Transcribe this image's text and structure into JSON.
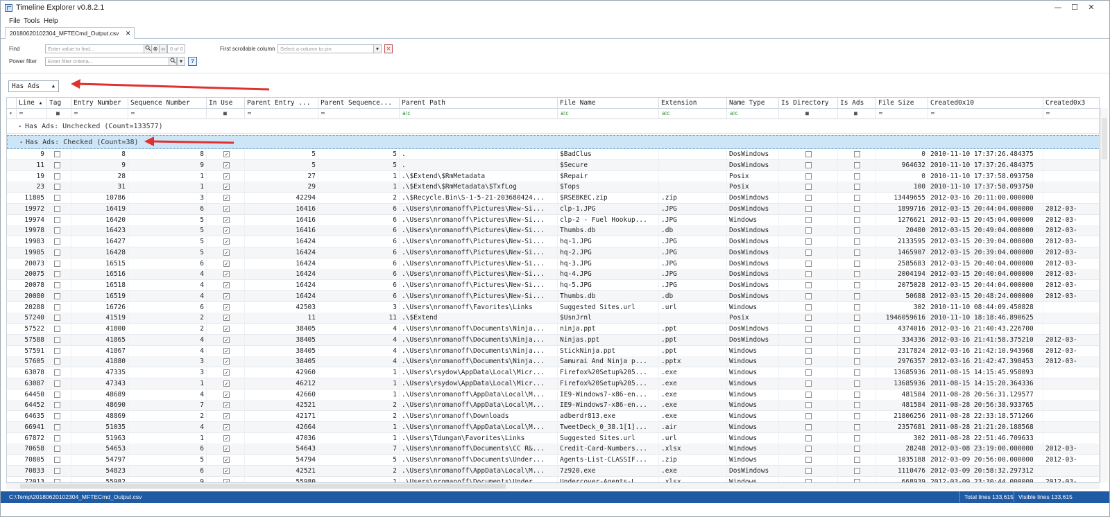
{
  "window": {
    "title": "Timeline Explorer v0.8.2.1",
    "minimize": "—",
    "maximize": "☐",
    "close": "✕"
  },
  "menu": [
    "File",
    "Tools",
    "Help"
  ],
  "tab": {
    "label": "20180620102304_MFTECmd_Output.csv",
    "close": "✕"
  },
  "find": {
    "label": "Find",
    "placeholder": "Enter value to find...",
    "counter": "0 of 0",
    "power_filter_label": "Power filter",
    "power_filter_placeholder": "Enter filter criteria...",
    "help": "?",
    "first_scrollable_label": "First scrollable column",
    "first_scrollable_placeholder": "Select a column to pin"
  },
  "grouping": {
    "chip": "Has Ads"
  },
  "columns": [
    "Line",
    "Tag",
    "Entry Number",
    "Sequence Number",
    "In Use",
    "Parent Entry ...",
    "Parent Sequence...",
    "Parent Path",
    "File Name",
    "Extension",
    "Name Type",
    "Is Directory",
    "Is Ads",
    "File Size",
    "Created0x10",
    "Created0x3"
  ],
  "groups": {
    "unchecked": "Has Ads: Unchecked (Count=133577)",
    "checked": "Has Ads: Checked (Count=38)"
  },
  "rows": [
    [
      "9",
      "8",
      "8",
      "5",
      "5",
      ".",
      "$BadClus",
      "",
      "DosWindows",
      "0",
      "2010-11-10 17:37:26.484375",
      ""
    ],
    [
      "11",
      "9",
      "9",
      "5",
      "5",
      ".",
      "$Secure",
      "",
      "DosWindows",
      "964632",
      "2010-11-10 17:37:26.484375",
      ""
    ],
    [
      "19",
      "28",
      "1",
      "27",
      "1",
      ".\\$Extend\\$RmMetadata",
      "$Repair",
      "",
      "Posix",
      "0",
      "2010-11-10 17:37:58.093750",
      ""
    ],
    [
      "23",
      "31",
      "1",
      "29",
      "1",
      ".\\$Extend\\$RmMetadata\\$TxfLog",
      "$Tops",
      "",
      "Posix",
      "100",
      "2010-11-10 17:37:58.093750",
      ""
    ],
    [
      "11805",
      "10786",
      "3",
      "42294",
      "2",
      ".\\$Recycle.Bin\\S-1-5-21-203680424...",
      "$RSEBKEC.zip",
      ".zip",
      "DosWindows",
      "13449655",
      "2012-03-16 20:11:00.000000",
      ""
    ],
    [
      "19972",
      "16419",
      "6",
      "16416",
      "6",
      ".\\Users\\nromanoff\\Pictures\\New-Si...",
      "clp-1.JPG",
      ".JPG",
      "DosWindows",
      "1899716",
      "2012-03-15 20:44:04.000000",
      "2012-03-"
    ],
    [
      "19974",
      "16420",
      "5",
      "16416",
      "6",
      ".\\Users\\nromanoff\\Pictures\\New-Si...",
      "clp-2 - Fuel Hookup...",
      ".JPG",
      "Windows",
      "1276621",
      "2012-03-15 20:45:04.000000",
      "2012-03-"
    ],
    [
      "19978",
      "16423",
      "5",
      "16416",
      "6",
      ".\\Users\\nromanoff\\Pictures\\New-Si...",
      "Thumbs.db",
      ".db",
      "DosWindows",
      "20480",
      "2012-03-15 20:49:04.000000",
      "2012-03-"
    ],
    [
      "19983",
      "16427",
      "5",
      "16424",
      "6",
      ".\\Users\\nromanoff\\Pictures\\New-Si...",
      "hq-1.JPG",
      ".JPG",
      "DosWindows",
      "2133595",
      "2012-03-15 20:39:04.000000",
      "2012-03-"
    ],
    [
      "19985",
      "16428",
      "5",
      "16424",
      "6",
      ".\\Users\\nromanoff\\Pictures\\New-Si...",
      "hq-2.JPG",
      ".JPG",
      "DosWindows",
      "1465907",
      "2012-03-15 20:39:04.000000",
      "2012-03-"
    ],
    [
      "20073",
      "16515",
      "6",
      "16424",
      "6",
      ".\\Users\\nromanoff\\Pictures\\New-Si...",
      "hq-3.JPG",
      ".JPG",
      "DosWindows",
      "2585683",
      "2012-03-15 20:40:04.000000",
      "2012-03-"
    ],
    [
      "20075",
      "16516",
      "4",
      "16424",
      "6",
      ".\\Users\\nromanoff\\Pictures\\New-Si...",
      "hq-4.JPG",
      ".JPG",
      "DosWindows",
      "2004194",
      "2012-03-15 20:40:04.000000",
      "2012-03-"
    ],
    [
      "20078",
      "16518",
      "4",
      "16424",
      "6",
      ".\\Users\\nromanoff\\Pictures\\New-Si...",
      "hq-5.JPG",
      ".JPG",
      "DosWindows",
      "2075028",
      "2012-03-15 20:44:04.000000",
      "2012-03-"
    ],
    [
      "20080",
      "16519",
      "4",
      "16424",
      "6",
      ".\\Users\\nromanoff\\Pictures\\New-Si...",
      "Thumbs.db",
      ".db",
      "DosWindows",
      "50688",
      "2012-03-15 20:48:24.000000",
      "2012-03-"
    ],
    [
      "20288",
      "16726",
      "6",
      "42503",
      "3",
      ".\\Users\\nromanoff\\Favorites\\Links",
      "Suggested Sites.url",
      ".url",
      "Windows",
      "302",
      "2010-11-10 08:44:09.450828",
      ""
    ],
    [
      "57240",
      "41519",
      "2",
      "11",
      "11",
      ".\\$Extend",
      "$UsnJrnl",
      "",
      "Posix",
      "1946059616",
      "2010-11-10 18:18:46.890625",
      ""
    ],
    [
      "57522",
      "41800",
      "2",
      "38405",
      "4",
      ".\\Users\\nromanoff\\Documents\\Ninja...",
      "ninja.ppt",
      ".ppt",
      "DosWindows",
      "4374016",
      "2012-03-16 21:40:43.226700",
      ""
    ],
    [
      "57588",
      "41865",
      "4",
      "38405",
      "4",
      ".\\Users\\nromanoff\\Documents\\Ninja...",
      "Ninjas.ppt",
      ".ppt",
      "DosWindows",
      "334336",
      "2012-03-16 21:41:58.375210",
      "2012-03-"
    ],
    [
      "57591",
      "41867",
      "4",
      "38405",
      "4",
      ".\\Users\\nromanoff\\Documents\\Ninja...",
      "StickNinja.ppt",
      ".ppt",
      "Windows",
      "2317824",
      "2012-03-16 21:42:10.943968",
      "2012-03-"
    ],
    [
      "57605",
      "41880",
      "3",
      "38405",
      "4",
      ".\\Users\\nromanoff\\Documents\\Ninja...",
      "Samurai And Ninja p...",
      ".pptx",
      "Windows",
      "2976357",
      "2012-03-16 21:42:47.398453",
      "2012-03-"
    ],
    [
      "63078",
      "47335",
      "3",
      "42960",
      "1",
      ".\\Users\\rsydow\\AppData\\Local\\Micr...",
      "Firefox%20Setup%205...",
      ".exe",
      "Windows",
      "13685936",
      "2011-08-15 14:15:45.958093",
      ""
    ],
    [
      "63087",
      "47343",
      "1",
      "46212",
      "1",
      ".\\Users\\rsydow\\AppData\\Local\\Micr...",
      "Firefox%20Setup%205...",
      ".exe",
      "Windows",
      "13685936",
      "2011-08-15 14:15:20.364336",
      ""
    ],
    [
      "64450",
      "48689",
      "4",
      "42660",
      "1",
      ".\\Users\\nromanoff\\AppData\\Local\\M...",
      "IE9-Windows7-x86-en...",
      ".exe",
      "Windows",
      "481584",
      "2011-08-28 20:56:31.129577",
      ""
    ],
    [
      "64452",
      "48690",
      "7",
      "42521",
      "2",
      ".\\Users\\nromanoff\\AppData\\Local\\M...",
      "IE9-Windows7-x86-en...",
      ".exe",
      "Windows",
      "481584",
      "2011-08-28 20:56:38.933765",
      ""
    ],
    [
      "64635",
      "48869",
      "2",
      "42171",
      "2",
      ".\\Users\\nromanoff\\Downloads",
      "adberdr813.exe",
      ".exe",
      "Windows",
      "21806256",
      "2011-08-28 22:33:18.571266",
      ""
    ],
    [
      "66941",
      "51035",
      "4",
      "42664",
      "1",
      ".\\Users\\nromanoff\\AppData\\Local\\M...",
      "TweetDeck_0_38.1[1]...",
      ".air",
      "Windows",
      "2357681",
      "2011-08-28 21:21:20.188568",
      ""
    ],
    [
      "67872",
      "51963",
      "1",
      "47036",
      "1",
      ".\\Users\\Tdungan\\Favorites\\Links",
      "Suggested Sites.url",
      ".url",
      "Windows",
      "302",
      "2011-08-28 22:51:46.709633",
      ""
    ],
    [
      "70658",
      "54653",
      "6",
      "54643",
      "7",
      ".\\Users\\nromanoff\\Documents\\CC R&...",
      "Credit-Card-Numbers...",
      ".xlsx",
      "Windows",
      "28248",
      "2012-03-08 23:19:00.000000",
      "2012-03-"
    ],
    [
      "70805",
      "54797",
      "5",
      "54794",
      "5",
      ".\\Users\\nromanoff\\Documents\\Under...",
      "Agents-List-CLASSIF...",
      ".zip",
      "Windows",
      "1035188",
      "2012-03-09 20:56:00.000000",
      "2012-03-"
    ],
    [
      "70833",
      "54823",
      "6",
      "42521",
      "2",
      ".\\Users\\nromanoff\\AppData\\Local\\M...",
      "7z920.exe",
      ".exe",
      "DosWindows",
      "1110476",
      "2012-03-09 20:58:32.297312",
      ""
    ],
    [
      "72013",
      "55982",
      "9",
      "55980",
      "1",
      ".\\Users\\nromanoff\\Documents\\Under...",
      "Undercover-Agents-L...",
      ".xlsx",
      "Windows",
      "668939",
      "2012-03-09 23:30:44.000000",
      "2012-03-"
    ]
  ],
  "status": {
    "path": "C:\\Temp\\20180620102304_MFTECmd_Output.csv",
    "total": "Total lines 133,615",
    "visible": "Visible lines 133,615"
  },
  "colors": {
    "accent": "#1f5ba5",
    "selected_group": "#cde6f7",
    "annotation_arrow": "#e03030"
  }
}
